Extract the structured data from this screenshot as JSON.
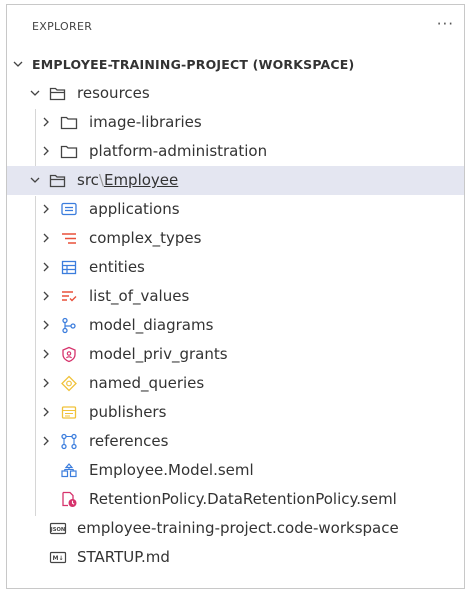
{
  "explorer": {
    "title": "EXPLORER",
    "more_icon": "ellipsis-icon",
    "more_glyph": "···"
  },
  "workspace": {
    "label": "EMPLOYEE-TRAINING-PROJECT (WORKSPACE)"
  },
  "resources": {
    "label": "resources",
    "children": [
      {
        "label": "image-libraries",
        "icon": "folder-icon"
      },
      {
        "label": "platform-administration",
        "icon": "folder-icon"
      }
    ]
  },
  "src": {
    "prefix": "src",
    "separator": "\\",
    "name": "Employee",
    "children": [
      {
        "label": "applications",
        "icon": "applications-icon",
        "color": "#3b7ddd"
      },
      {
        "label": "complex_types",
        "icon": "complex-types-icon",
        "color": "#e8503a"
      },
      {
        "label": "entities",
        "icon": "entities-icon",
        "color": "#3b7ddd"
      },
      {
        "label": "list_of_values",
        "icon": "list-of-values-icon",
        "color": "#e8503a"
      },
      {
        "label": "model_diagrams",
        "icon": "model-diagrams-icon",
        "color": "#3b7ddd"
      },
      {
        "label": "model_priv_grants",
        "icon": "shield-icon",
        "color": "#d6336c"
      },
      {
        "label": "named_queries",
        "icon": "named-queries-icon",
        "color": "#f0c23b"
      },
      {
        "label": "publishers",
        "icon": "publishers-icon",
        "color": "#f0c23b"
      },
      {
        "label": "references",
        "icon": "references-icon",
        "color": "#3b7ddd"
      }
    ],
    "files": [
      {
        "label": "Employee.Model.seml",
        "icon": "model-file-icon"
      },
      {
        "label": "RetentionPolicy.DataRetentionPolicy.seml",
        "icon": "retention-policy-icon"
      }
    ]
  },
  "root_files": [
    {
      "label": "employee-training-project.code-workspace",
      "icon": "json-file-icon",
      "tag": "JSON"
    },
    {
      "label": "STARTUP.md",
      "icon": "markdown-file-icon",
      "tag": "M↓"
    }
  ]
}
